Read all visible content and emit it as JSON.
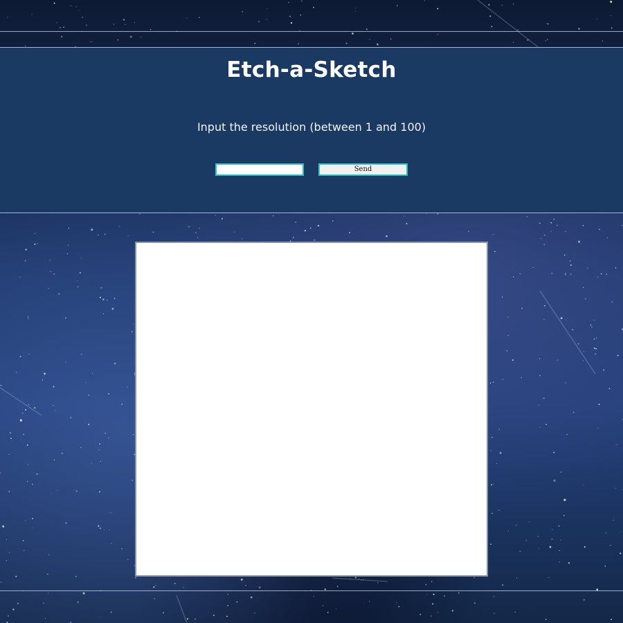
{
  "app": {
    "title": "Etch-a-Sketch"
  },
  "controls": {
    "prompt": "Input the resolution (between 1 and 100)",
    "resolution_value": "",
    "resolution_placeholder": "",
    "send_label": "Send",
    "accent_color": "#33c2c2"
  },
  "theme": {
    "header_color": "#1b3a63",
    "board_color": "#ffffff",
    "background": "starry night sky"
  }
}
